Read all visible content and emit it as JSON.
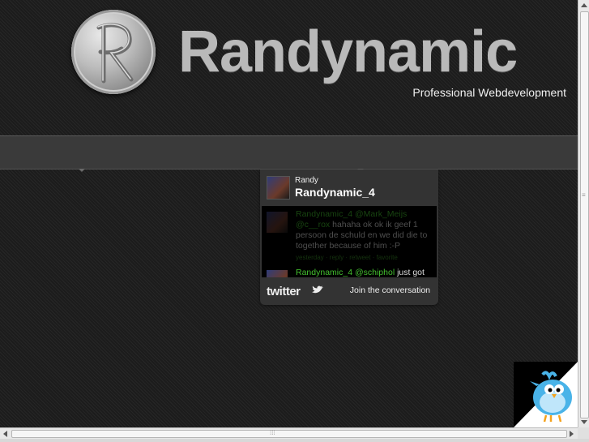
{
  "header": {
    "brand": "Randynamic",
    "tagline": "Professional Webdevelopment"
  },
  "twitter_widget": {
    "name": "Randy",
    "handle": "Randynamic_4",
    "tweets": [
      {
        "user": "Randynamic_4",
        "mention": "@Mark_Meijs",
        "text_mention2": "@c__rox",
        "text": " hahaha ok ok ik geef 1 persoon de schuld en we did die to together because of him :-P",
        "meta": "yesterday · reply · retweet · favorite"
      },
      {
        "user": "Randynamic_4",
        "mention": "@schiphol",
        "text": " just got"
      }
    ],
    "footer_logo": "twitter",
    "join_label": "Join the conversation"
  },
  "icons": {
    "logo": "r-coin-logo-icon",
    "bird": "twitter-bird-icon",
    "corner_bird": "twitter-bird-corner-icon"
  },
  "colors": {
    "background": "#1c1c1c",
    "brand_text": "#b9b9b9",
    "tweet_link": "#44c12f"
  }
}
